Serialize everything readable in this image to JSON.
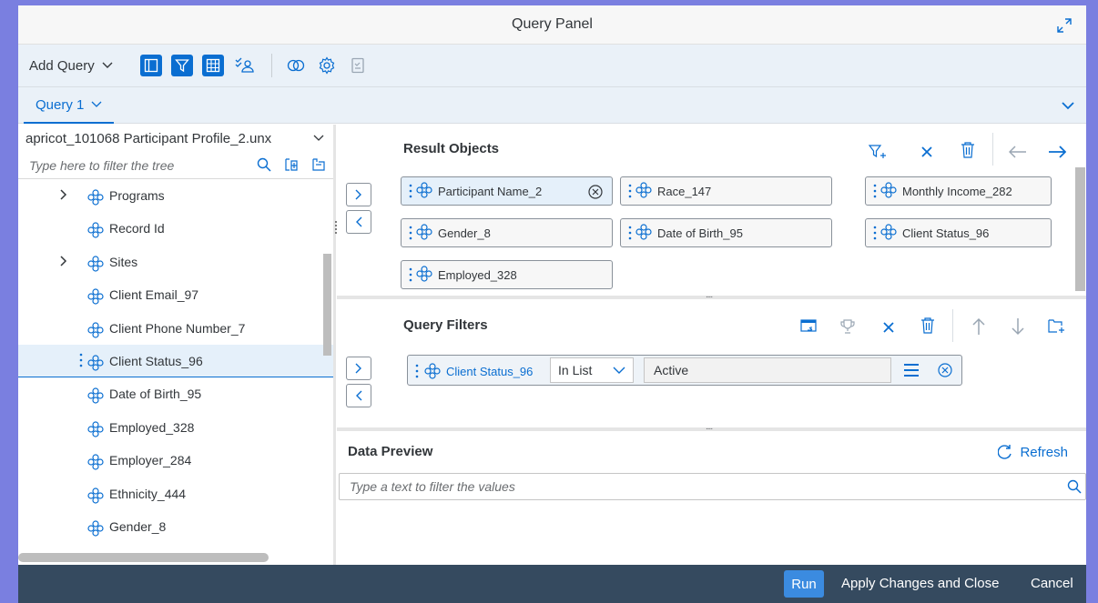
{
  "window": {
    "title": "Query Panel"
  },
  "toolbar": {
    "add_query_label": "Add Query"
  },
  "tabs": {
    "active_label": "Query 1"
  },
  "tree": {
    "universe_name": "apricot_101068 Participant Profile_2.unx",
    "filter_placeholder": "Type here to filter the tree",
    "items": [
      {
        "label": "Programs",
        "expandable": true
      },
      {
        "label": "Record Id",
        "expandable": false
      },
      {
        "label": "Sites",
        "expandable": true
      },
      {
        "label": "Client Email_97",
        "expandable": false
      },
      {
        "label": "Client Phone Number_7",
        "expandable": false
      },
      {
        "label": "Client Status_96",
        "expandable": false,
        "selected": true
      },
      {
        "label": "Date of Birth_95",
        "expandable": false
      },
      {
        "label": "Employed_328",
        "expandable": false
      },
      {
        "label": "Employer_284",
        "expandable": false
      },
      {
        "label": "Ethnicity_444",
        "expandable": false
      },
      {
        "label": "Gender_8",
        "expandable": false
      }
    ]
  },
  "result_objects": {
    "title": "Result Objects",
    "items": [
      {
        "label": "Participant Name_2"
      },
      {
        "label": "Race_147"
      },
      {
        "label": "Monthly Income_282"
      },
      {
        "label": "Gender_8"
      },
      {
        "label": "Date of Birth_95"
      },
      {
        "label": "Client Status_96"
      },
      {
        "label": "Employed_328"
      }
    ]
  },
  "query_filters": {
    "title": "Query Filters",
    "filter": {
      "object": "Client Status_96",
      "operator": "In List",
      "value": "Active"
    }
  },
  "data_preview": {
    "title": "Data Preview",
    "refresh_label": "Refresh",
    "filter_placeholder": "Type a text to filter the values"
  },
  "footer": {
    "run_label": "Run",
    "apply_label": "Apply Changes and Close",
    "cancel_label": "Cancel"
  },
  "colors": {
    "accent": "#0a6ed1",
    "footer_bg": "#354a5f",
    "toolbar_bg": "#eaf1f8",
    "outer_bg": "#7a7fe0"
  }
}
